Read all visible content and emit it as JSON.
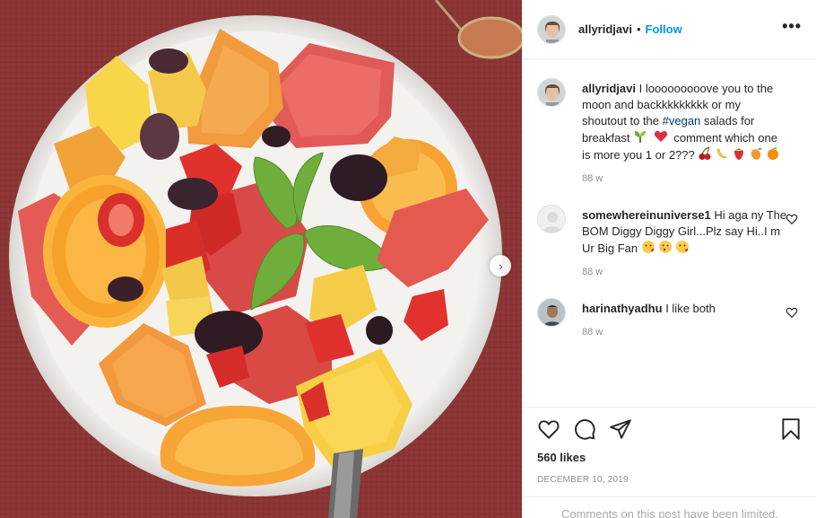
{
  "header": {
    "username": "allyridjavi",
    "separator": "•",
    "follow_label": "Follow",
    "more_label": "•••"
  },
  "comments": [
    {
      "username": "allyridjavi",
      "text_before": " I looooooooove you to the moon and backkkkkkkkk or my shoutout to the ",
      "hashtag": "#vegan",
      "text_after": " salads for breakfast",
      "text_after2": " comment which one is more you 1 or 2???",
      "time": "88 w"
    },
    {
      "username": "somewhereinuniverse1",
      "text": " Hi aga ny The BOM Diggy Diggy Girl...Plz say Hi..I m Ur Big Fan",
      "time": "88 w"
    },
    {
      "username": "harinathyadhu",
      "text": " I like both",
      "time": "88 w"
    }
  ],
  "likes": "560 likes",
  "date": "DECEMBER 10, 2019",
  "limited_notice": "Comments on this post have been limited.",
  "icons": {
    "like": "heart-outline",
    "comment": "speech-bubble",
    "share": "paper-plane",
    "save": "bookmark",
    "next": "chevron-right"
  }
}
